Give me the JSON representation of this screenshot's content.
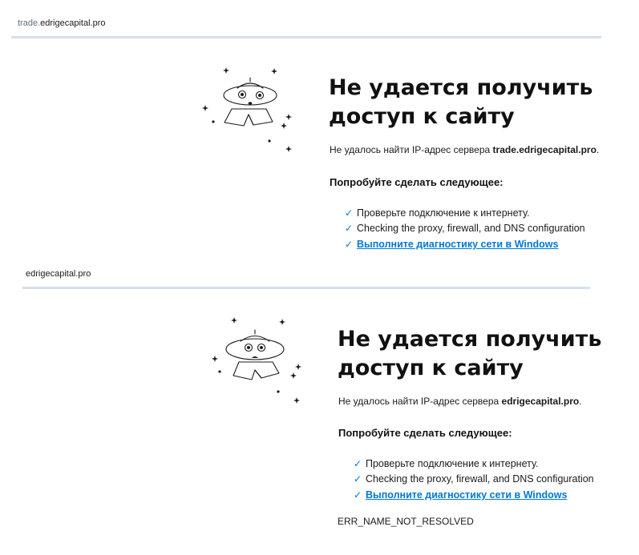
{
  "panel_1": {
    "url_prefix": "trade.",
    "url_domain": "edrigecapital.pro",
    "heading_line_1": "Не удается получить",
    "heading_line_2": "доступ к сайту",
    "desc_prefix": "Не удалось найти IP-адрес сервера",
    "desc_host": "trade.edrigecapital.pro",
    "desc_suffix": ".",
    "try_title": "Попробуйте сделать следующее:",
    "suggestions": [
      "Проверьте подключение к интернету.",
      "Checking the proxy, firewall, and DNS configuration",
      "Выполните диагностику сети в Windows"
    ]
  },
  "panel_2": {
    "url": "edrigecapital.pro",
    "heading_line_1": "Не удается получить",
    "heading_line_2": "доступ к сайту",
    "desc_prefix": "Не удалось найти IP-адрес сервера",
    "desc_host": "edrigecapital.pro",
    "desc_suffix": ".",
    "try_title": "Попробуйте сделать следующее:",
    "suggestions": [
      "Проверьте подключение к интернету.",
      "Checking the proxy, firewall, and DNS configuration",
      "Выполните диагностику сети в Windows"
    ],
    "error_code": "ERR_NAME_NOT_RESOLVED"
  },
  "icons": {
    "check": "check-icon",
    "illustration": "ufo-illustration"
  },
  "colors": {
    "link": "#0078d4",
    "check": "#0078d4",
    "divider": "#d5e0ec",
    "url_subdomain": "#5d6f84"
  }
}
